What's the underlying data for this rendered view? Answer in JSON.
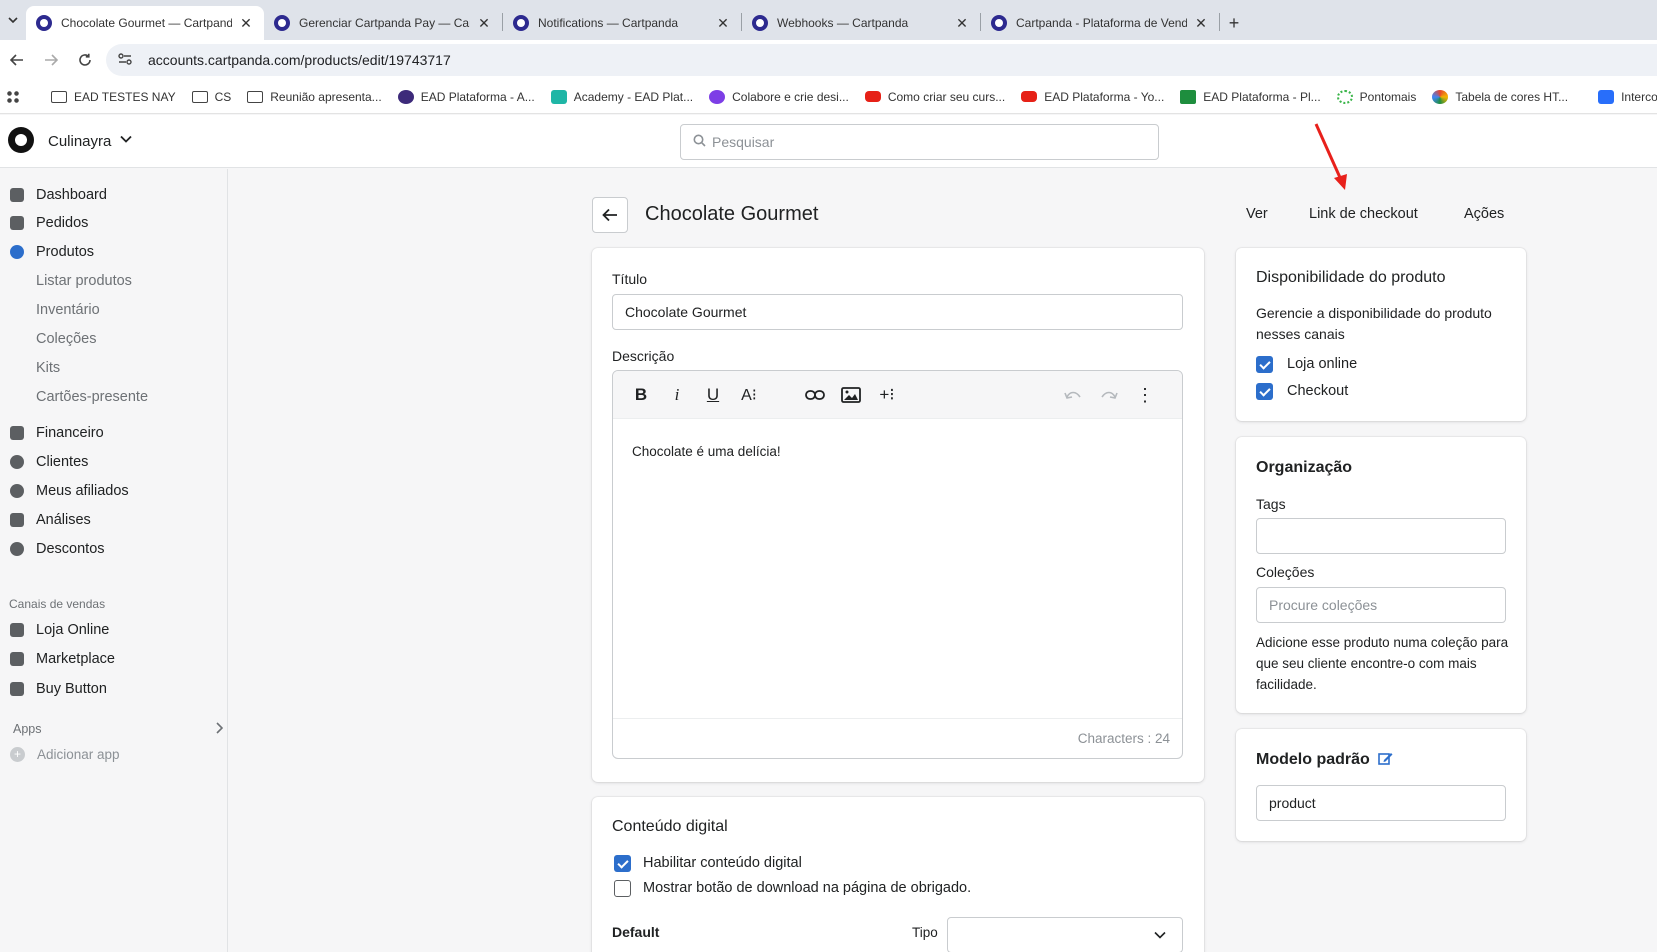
{
  "browser": {
    "tabs": [
      {
        "title": "Chocolate Gourmet — Cartpanda",
        "active": true
      },
      {
        "title": "Gerenciar Cartpanda Pay — Cartpanda",
        "active": false
      },
      {
        "title": "Notifications — Cartpanda",
        "active": false
      },
      {
        "title": "Webhooks — Cartpanda",
        "active": false
      },
      {
        "title": "Cartpanda - Plataforma de Vendas",
        "active": false
      }
    ],
    "url": "accounts.cartpanda.com/products/edit/19743717",
    "bookmarks": [
      {
        "label": "EAD TESTES NAY",
        "icon": "folder-icon"
      },
      {
        "label": "CS",
        "icon": "folder-icon"
      },
      {
        "label": "Reunião apresenta...",
        "icon": "folder-icon"
      },
      {
        "label": "EAD Plataforma - A...",
        "icon": "ead-icon"
      },
      {
        "label": "Academy - EAD Plat...",
        "icon": "academy-icon"
      },
      {
        "label": "Colabore e crie desi...",
        "icon": "canva-icon"
      },
      {
        "label": "Como criar seu curs...",
        "icon": "youtube-icon"
      },
      {
        "label": "EAD Plataforma - Yo...",
        "icon": "youtube-icon"
      },
      {
        "label": "EAD Plataforma - Pl...",
        "icon": "sheets-icon"
      },
      {
        "label": "Pontomais",
        "icon": "pontomais-icon"
      },
      {
        "label": "Tabela de cores HT...",
        "icon": "tabela-icon"
      },
      {
        "label": "Intercom | Th",
        "icon": "intercom-icon"
      }
    ]
  },
  "header": {
    "store_name": "Culinayra",
    "search_placeholder": "Pesquisar"
  },
  "sidebar": {
    "items": [
      {
        "label": "Dashboard",
        "icon": "dashboard-icon"
      },
      {
        "label": "Pedidos",
        "icon": "orders-icon"
      },
      {
        "label": "Produtos",
        "icon": "products-icon",
        "active": true
      }
    ],
    "subitems": [
      "Listar produtos",
      "Inventário",
      "Coleções",
      "Kits",
      "Cartões-presente"
    ],
    "items2": [
      {
        "label": "Financeiro",
        "icon": "finance-icon"
      },
      {
        "label": "Clientes",
        "icon": "customers-icon"
      },
      {
        "label": "Meus afiliados",
        "icon": "affiliates-icon"
      },
      {
        "label": "Análises",
        "icon": "analytics-icon"
      },
      {
        "label": "Descontos",
        "icon": "discounts-icon"
      }
    ],
    "sales_channels_title": "Canais de vendas",
    "channels": [
      {
        "label": "Loja Online",
        "icon": "store-icon"
      },
      {
        "label": "Marketplace",
        "icon": "marketplace-icon"
      },
      {
        "label": "Buy Button",
        "icon": "cart-icon"
      }
    ],
    "apps_title": "Apps",
    "add_app": "Adicionar app"
  },
  "page": {
    "title": "Chocolate Gourmet",
    "actions": {
      "view": "Ver",
      "checkout_link": "Link de checkout",
      "actions": "Ações"
    }
  },
  "product": {
    "title_label": "Título",
    "title_value": "Chocolate Gourmet",
    "description_label": "Descrição",
    "description_text": "Chocolate é uma delícia!",
    "char_count": "Characters : 24"
  },
  "digital": {
    "title": "Conteúdo digital",
    "enable_label": "Habilitar conteúdo digital",
    "enable_checked": true,
    "download_label": "Mostrar botão de download na página de obrigado.",
    "download_checked": false,
    "default_label": "Default",
    "type_label": "Tipo",
    "type_value": ""
  },
  "availability": {
    "title": "Disponibilidade do produto",
    "description": "Gerencie a disponibilidade do produto nesses canais",
    "channels": [
      {
        "label": "Loja online",
        "checked": true
      },
      {
        "label": "Checkout",
        "checked": true
      }
    ]
  },
  "organization": {
    "title": "Organização",
    "tags_label": "Tags",
    "tags_value": "",
    "collections_label": "Coleções",
    "collections_placeholder": "Procure coleções",
    "help_text": "Adicione esse produto numa coleção para que seu cliente encontre-o com mais facilidade."
  },
  "template": {
    "title": "Modelo padrão",
    "value": "product"
  },
  "colors": {
    "accent": "#2c6ecb",
    "annotation_arrow": "#e8201b"
  }
}
